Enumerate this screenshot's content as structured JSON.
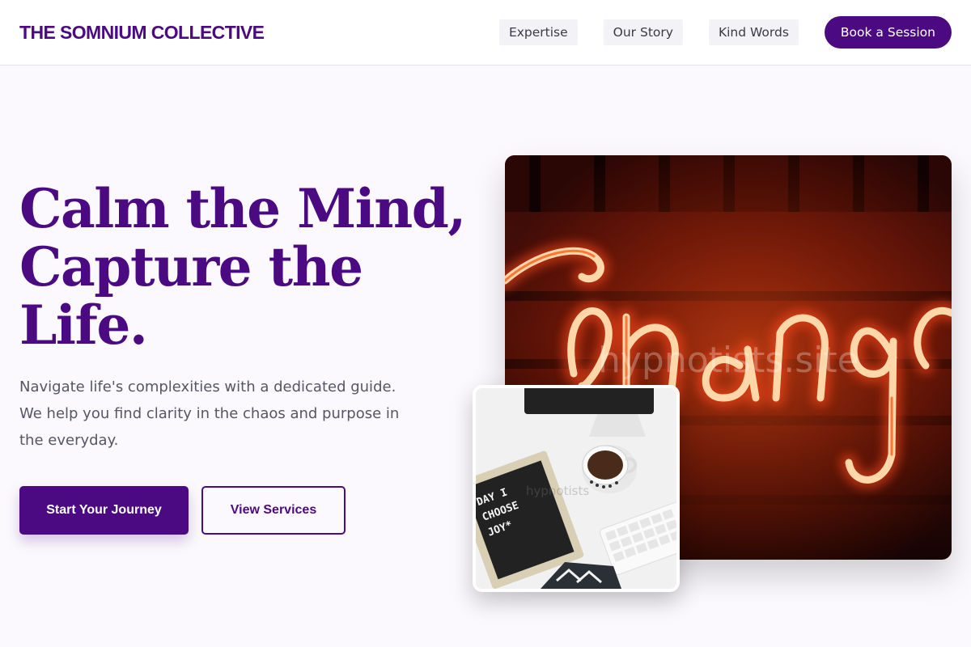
{
  "header": {
    "logo": "THE SOMNIUM COLLECTIVE",
    "nav": [
      "Expertise",
      "Our Story",
      "Kind Words"
    ],
    "cta": "Book a Session"
  },
  "hero": {
    "title_lines": [
      "Calm the Mind,",
      "Capture the",
      "Life."
    ],
    "description_lines": [
      "Navigate life's complexities with a dedicated guide.",
      "We help you find clarity in the chaos and purpose in",
      "the everyday."
    ],
    "primary_button": "Start Your Journey",
    "secondary_button": "View Services"
  },
  "images": {
    "main_neon_text": "change",
    "watermark_main": "hypnotists.site",
    "watermark_small": "hypnotists",
    "letterboard_lines": [
      "DAY I",
      "CHOOSE",
      "JOY*"
    ]
  },
  "colors": {
    "brand": "#4b0a82",
    "background": "#fbf9fd",
    "body_text": "#565664"
  }
}
